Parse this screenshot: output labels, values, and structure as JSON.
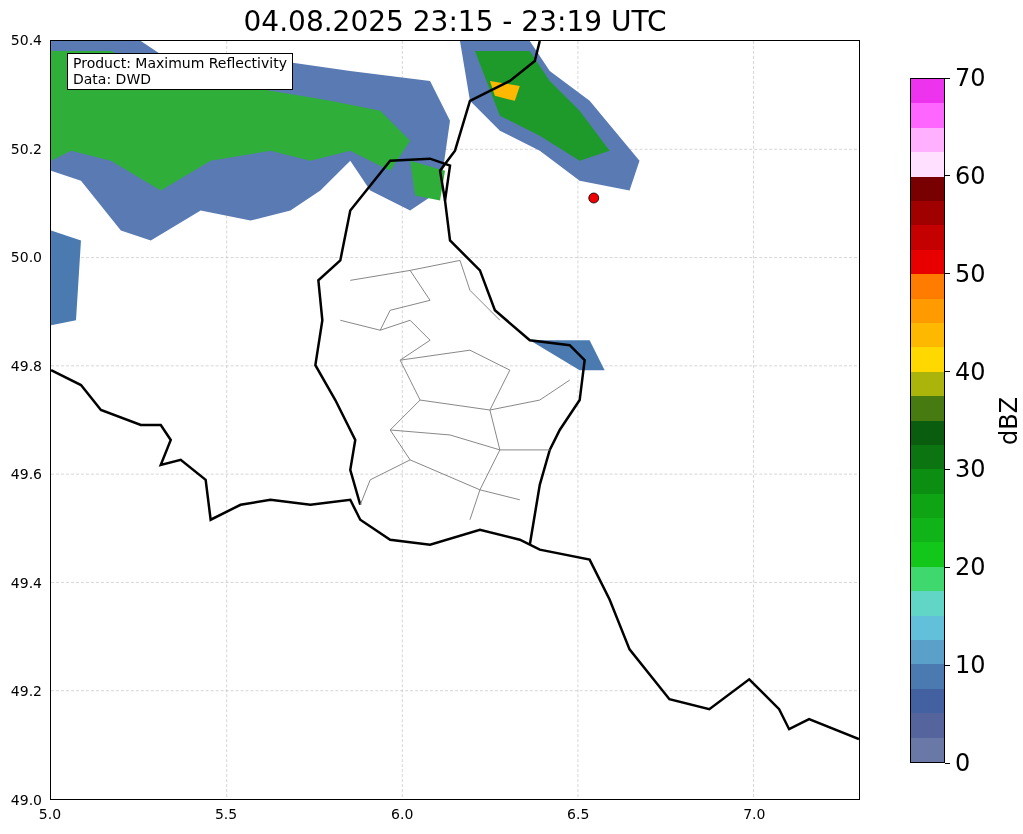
{
  "title": "04.08.2025 23:15 - 23:19 UTC",
  "info_box": {
    "lines": [
      "Product: Maximum Reflectivity",
      "Data: DWD"
    ]
  },
  "x_ticks": [
    "5.0",
    "5.5",
    "6.0",
    "6.5",
    "7.0"
  ],
  "y_ticks": [
    "50.4",
    "50.2",
    "50.0",
    "49.8",
    "49.6",
    "49.4",
    "49.2",
    "49.0"
  ],
  "colorbar": {
    "label": "dBZ",
    "ticks": [
      "70",
      "60",
      "50",
      "40",
      "30",
      "20",
      "10",
      "0"
    ],
    "segments": [
      {
        "color": "#6a78a8"
      },
      {
        "color": "#56649e"
      },
      {
        "color": "#4360a0"
      },
      {
        "color": "#4a7ab0"
      },
      {
        "color": "#5aa0c8"
      },
      {
        "color": "#62c0da"
      },
      {
        "color": "#62d6c6"
      },
      {
        "color": "#3ed86e"
      },
      {
        "color": "#12c61a"
      },
      {
        "color": "#10b418"
      },
      {
        "color": "#0ea414"
      },
      {
        "color": "#0c8e12"
      },
      {
        "color": "#0c7410"
      },
      {
        "color": "#0a5c0e"
      },
      {
        "color": "#487a12"
      },
      {
        "color": "#aab40a"
      },
      {
        "color": "#ffd800"
      },
      {
        "color": "#ffb800"
      },
      {
        "color": "#ff9a00"
      },
      {
        "color": "#ff7c00"
      },
      {
        "color": "#e80000"
      },
      {
        "color": "#c40000"
      },
      {
        "color": "#a00000"
      },
      {
        "color": "#780000"
      },
      {
        "color": "#ffe0ff"
      },
      {
        "color": "#ffb0ff"
      },
      {
        "color": "#ff66ff"
      },
      {
        "color": "#ee33ee"
      }
    ]
  }
}
